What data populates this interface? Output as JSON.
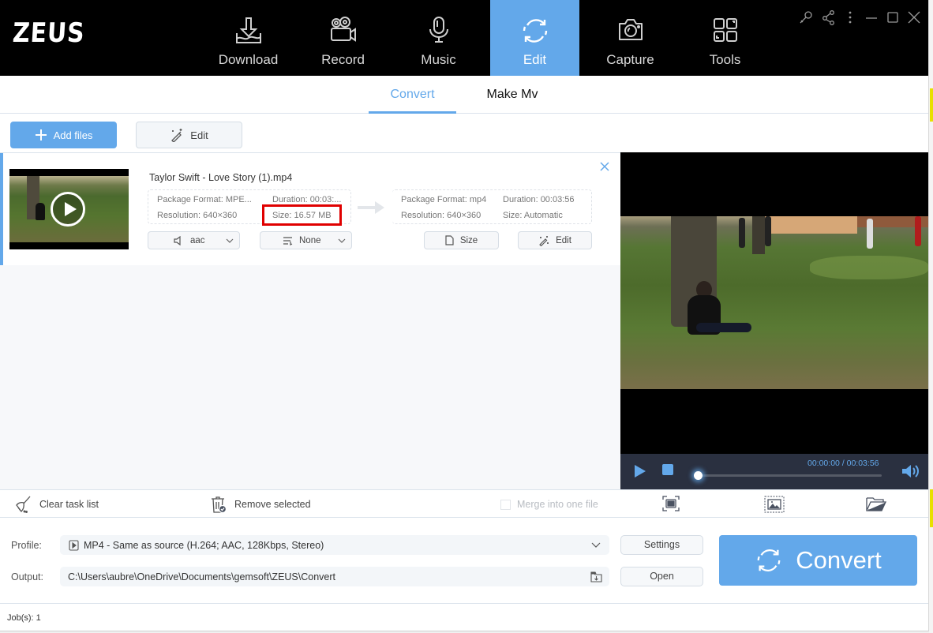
{
  "app": {
    "title": "ZEUS",
    "nav": [
      {
        "label": "Download",
        "icon": "download-icon",
        "active": false
      },
      {
        "label": "Record",
        "icon": "video-camera-icon",
        "active": false
      },
      {
        "label": "Music",
        "icon": "microphone-icon",
        "active": false
      },
      {
        "label": "Edit",
        "icon": "convert-refresh-icon",
        "active": true
      },
      {
        "label": "Capture",
        "icon": "camera-icon",
        "active": false
      },
      {
        "label": "Tools",
        "icon": "tools-grid-icon",
        "active": false
      }
    ],
    "window_controls": [
      "key-icon",
      "share-icon",
      "more-icon",
      "minimize-icon",
      "maximize-icon",
      "close-icon"
    ],
    "accent_color": "#63a8ea"
  },
  "subtabs": [
    {
      "label": "Convert",
      "active": true
    },
    {
      "label": "Make Mv",
      "active": false
    }
  ],
  "toolbar": {
    "add_files_label": "Add files",
    "edit_label": "Edit"
  },
  "file_item": {
    "name": "Taylor Swift - Love Story (1).mp4",
    "source": {
      "package_format": "Package Format: MPE...",
      "duration": "Duration:  00:03:...",
      "resolution": "Resolution: 640×360",
      "size": "Size: 16.57 MB"
    },
    "target": {
      "package_format": "Package Format: mp4",
      "duration": "Duration: 00:03:56",
      "resolution": "Resolution: 640×360",
      "size": "Size: Automatic"
    },
    "audio_select": "aac",
    "subtitle_select": "None",
    "size_button": "Size",
    "edit_button": "Edit",
    "highlight_color": "#e00000"
  },
  "list_actions": {
    "clear_label": "Clear task list",
    "remove_label": "Remove selected",
    "merge_label": "Merge into one file",
    "merge_checked": false
  },
  "player": {
    "time_current": "00:00:00",
    "time_total": "00:03:56",
    "time_display": "00:00:00 / 00:03:56",
    "progress": 0
  },
  "output": {
    "profile_label": "Profile:",
    "profile_value": "MP4 - Same as source (H.264; AAC, 128Kbps, Stereo)",
    "output_label": "Output:",
    "output_value": "C:\\Users\\aubre\\OneDrive\\Documents\\gemsoft\\ZEUS\\Convert",
    "settings_label": "Settings",
    "open_label": "Open",
    "convert_label": "Convert"
  },
  "status": {
    "jobs": "Job(s): 1"
  }
}
